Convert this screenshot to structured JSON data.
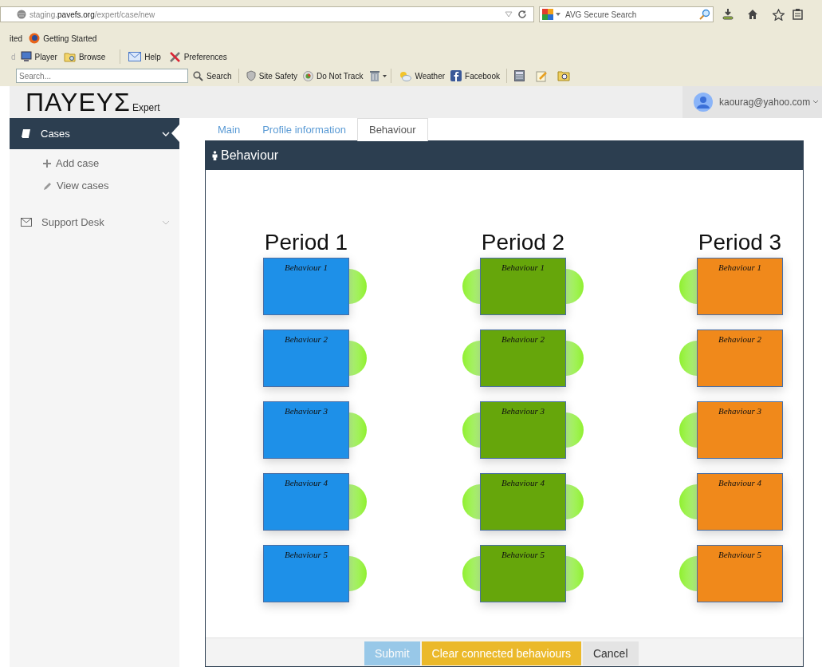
{
  "browser": {
    "url": {
      "host": "staging.",
      "domain": "pavefs.org",
      "path": "/expert/case/new"
    },
    "search_engine": "AVG Secure Search",
    "bookmarks": [
      "ited",
      "Getting Started"
    ],
    "toolbar": [
      "d",
      "Player",
      "Browse",
      "Help",
      "Preferences"
    ],
    "search_toolbar": {
      "placeholder": "Search...",
      "items": [
        "Search",
        "Site Safety",
        "Do Not Track",
        "Weather",
        "Facebook"
      ]
    }
  },
  "app": {
    "logo": "ΠΑΥΕΥΣ",
    "logo_suffix": "Expert",
    "user": "kaourag@yahoo.com"
  },
  "sidebar": {
    "items": [
      {
        "label": "Cases",
        "selected": true,
        "expanded": true,
        "children": [
          {
            "label": "Add case"
          },
          {
            "label": "View cases"
          }
        ]
      },
      {
        "label": "Support Desk",
        "selected": false,
        "expanded": false
      }
    ]
  },
  "tabs": [
    {
      "label": "Main",
      "selected": false
    },
    {
      "label": "Profile information",
      "selected": false
    },
    {
      "label": "Behaviour",
      "selected": true
    }
  ],
  "panel": {
    "title": "Behaviour",
    "periods": [
      {
        "title": "Period 1",
        "color": "#1e90e8",
        "left_connector": false,
        "right_connector": true,
        "behaviours": [
          "Behaviour 1",
          "Behaviour 2",
          "Behaviour 3",
          "Behaviour 4",
          "Behaviour 5"
        ]
      },
      {
        "title": "Period 2",
        "color": "#66a60b",
        "left_connector": true,
        "right_connector": true,
        "behaviours": [
          "Behaviour 1",
          "Behaviour 2",
          "Behaviour 3",
          "Behaviour 4",
          "Behaviour 5"
        ]
      },
      {
        "title": "Period 3",
        "color": "#f0891b",
        "left_connector": true,
        "right_connector": false,
        "behaviours": [
          "Behaviour 1",
          "Behaviour 2",
          "Behaviour 3",
          "Behaviour 4",
          "Behaviour 5"
        ]
      }
    ]
  },
  "buttons": [
    {
      "label": "Submit",
      "kind": "primary",
      "disabled": true
    },
    {
      "label": "Clear connected behaviours",
      "kind": "warning",
      "disabled": false
    },
    {
      "label": "Cancel",
      "kind": "default",
      "disabled": false
    }
  ]
}
